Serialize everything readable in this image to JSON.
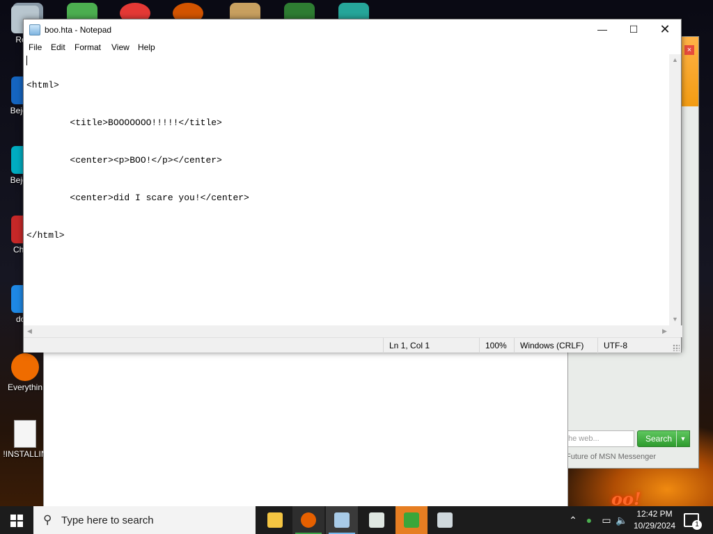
{
  "desktop": {
    "icons": [
      {
        "label": "Recy",
        "name": "recycle-bin"
      },
      {
        "label": "Beje De",
        "name": "bejeweled-deluxe"
      },
      {
        "label": "Beje De",
        "name": "bejeweled-deluxe-2"
      },
      {
        "label": "Ch De",
        "name": "chuzzle-deluxe"
      },
      {
        "label": "does",
        "name": "does"
      },
      {
        "label": "Everythin",
        "name": "everything"
      },
      {
        "label": "!INSTALLIN",
        "name": "installing-file"
      }
    ],
    "wallpaper_text": "oo!"
  },
  "messenger_window": {
    "search_placeholder": "he web...",
    "search_button": "Search",
    "footer_text": "Future of MSN Messenger"
  },
  "notepad": {
    "title": "boo.hta - Notepad",
    "menu": [
      "File",
      "Edit",
      "Format",
      "View",
      "Help"
    ],
    "lines": [
      "<html>",
      "        <title>BOOOOOOO!!!!!</title>",
      "        <center><p>BOO!</p></center>",
      "        <center>did I scare you!</center>",
      "</html>"
    ],
    "status": {
      "position": "Ln 1, Col 1",
      "zoom": "100%",
      "line_ending": "Windows (CRLF)",
      "encoding": "UTF-8"
    }
  },
  "taskbar": {
    "search_placeholder": "Type here to search",
    "time": "12:42 PM",
    "date": "10/29/2024",
    "notification_count": "1"
  }
}
